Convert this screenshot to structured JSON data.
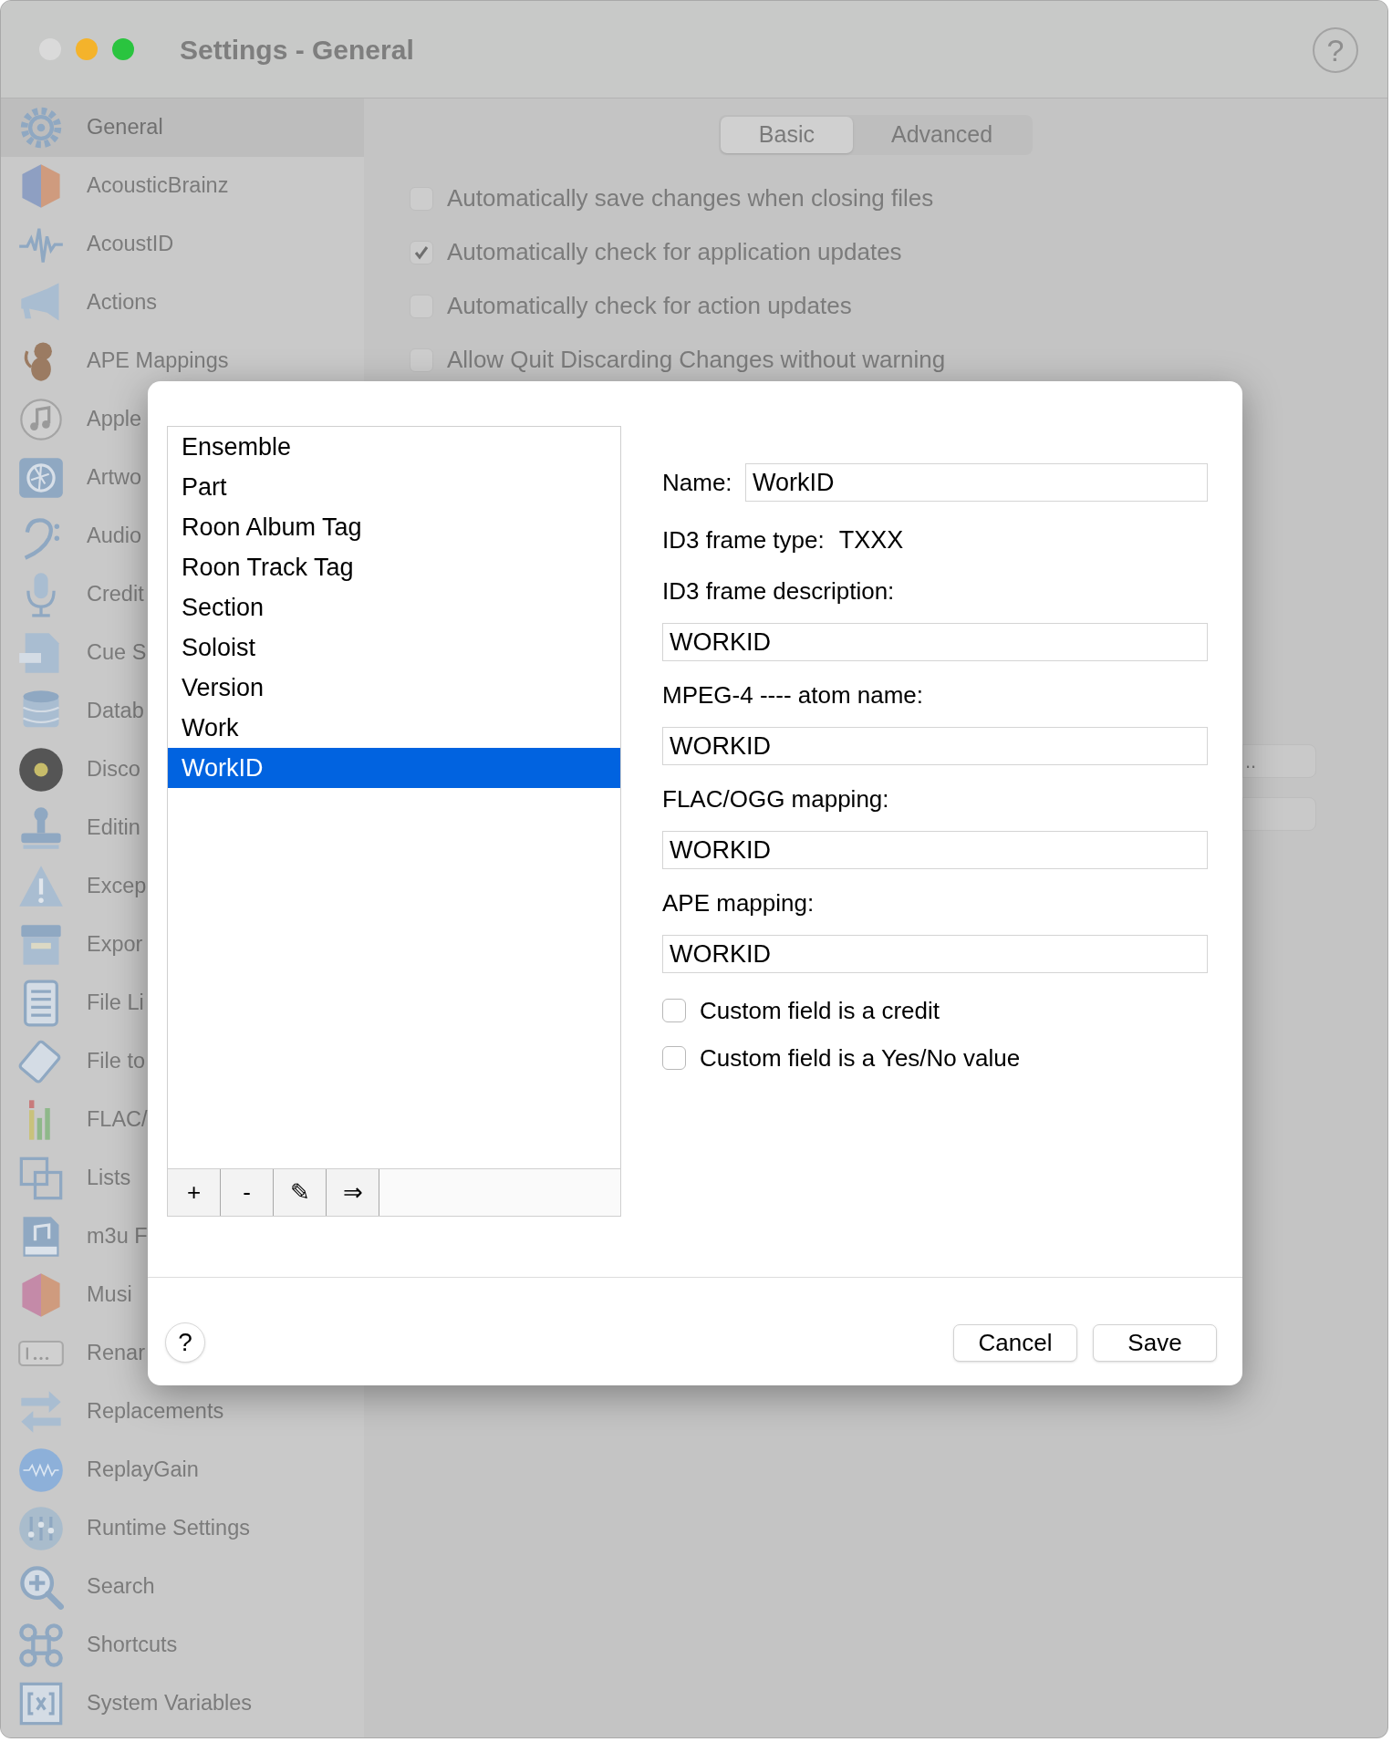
{
  "window": {
    "title": "Settings - General",
    "help": "?"
  },
  "sidebar": {
    "items": [
      {
        "label": "General",
        "selected": true
      },
      {
        "label": "AcousticBrainz",
        "selected": false
      },
      {
        "label": "AcoustID",
        "selected": false
      },
      {
        "label": "Actions",
        "selected": false
      },
      {
        "label": "APE Mappings",
        "selected": false
      },
      {
        "label": "Apple",
        "selected": false
      },
      {
        "label": "Artwo",
        "selected": false
      },
      {
        "label": "Audio",
        "selected": false
      },
      {
        "label": "Credit",
        "selected": false
      },
      {
        "label": "Cue S",
        "selected": false
      },
      {
        "label": "Datab",
        "selected": false
      },
      {
        "label": "Disco",
        "selected": false
      },
      {
        "label": "Editin",
        "selected": false
      },
      {
        "label": "Excep",
        "selected": false
      },
      {
        "label": "Expor",
        "selected": false
      },
      {
        "label": "File Li",
        "selected": false
      },
      {
        "label": "File to",
        "selected": false
      },
      {
        "label": "FLAC/",
        "selected": false
      },
      {
        "label": "Lists",
        "selected": false
      },
      {
        "label": "m3u F",
        "selected": false
      },
      {
        "label": "Musi",
        "selected": false
      },
      {
        "label": "Renar",
        "selected": false
      },
      {
        "label": "Replacements",
        "selected": false
      },
      {
        "label": "ReplayGain",
        "selected": false
      },
      {
        "label": "Runtime Settings",
        "selected": false
      },
      {
        "label": "Search",
        "selected": false
      },
      {
        "label": "Shortcuts",
        "selected": false
      },
      {
        "label": "System Variables",
        "selected": false
      }
    ]
  },
  "tabs": [
    {
      "label": "Basic",
      "selected": true
    },
    {
      "label": "Advanced",
      "selected": false
    }
  ],
  "options": [
    {
      "label": "Automatically save changes when closing files",
      "checked": false
    },
    {
      "label": "Automatically check for application updates",
      "checked": true
    },
    {
      "label": "Automatically check for action updates",
      "checked": false
    },
    {
      "label": "Allow Quit Discarding Changes without warning",
      "checked": false
    }
  ],
  "side_button": {
    "label": ".."
  },
  "dialog": {
    "list": {
      "items": [
        {
          "label": "Ensemble",
          "selected": false
        },
        {
          "label": "Part",
          "selected": false
        },
        {
          "label": "Roon Album Tag",
          "selected": false
        },
        {
          "label": "Roon Track Tag",
          "selected": false
        },
        {
          "label": "Section",
          "selected": false
        },
        {
          "label": "Soloist",
          "selected": false
        },
        {
          "label": "Version",
          "selected": false
        },
        {
          "label": "Work",
          "selected": false
        },
        {
          "label": "WorkID",
          "selected": true
        }
      ]
    },
    "toolbar": [
      "+",
      "-",
      "✎",
      "⇒"
    ],
    "name": {
      "label": "Name:",
      "value": "WorkID"
    },
    "frame_type": {
      "label": "ID3 frame type:",
      "value": "TXXX"
    },
    "fields": [
      {
        "label": "ID3 frame description:",
        "value": "WORKID"
      },
      {
        "label": "MPEG-4 ---- atom name:",
        "value": "WORKID"
      },
      {
        "label": "FLAC/OGG mapping:",
        "value": "WORKID"
      },
      {
        "label": "APE mapping:",
        "value": "WORKID"
      }
    ],
    "checkboxes": [
      {
        "label": "Custom field is a credit",
        "checked": false
      },
      {
        "label": "Custom field is a Yes/No value",
        "checked": false
      }
    ],
    "help": "?",
    "buttons": [
      "Cancel",
      "Save"
    ]
  }
}
